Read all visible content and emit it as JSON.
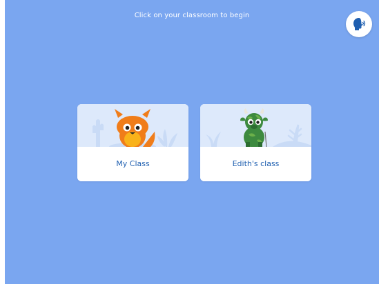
{
  "header": {
    "prompt": "Click on your classroom to begin"
  },
  "icons": {
    "voice": "speaking-head-icon",
    "card_1_avatar": "fox-monster-icon",
    "card_2_avatar": "green-monster-icon"
  },
  "classrooms": [
    {
      "name": "My Class"
    },
    {
      "name": "Edith's class"
    }
  ],
  "colors": {
    "background": "#7aa6f0",
    "card_art": "#dde9fb",
    "card_label": "#1f5fb0",
    "voice_icon": "#1f5fb0"
  }
}
